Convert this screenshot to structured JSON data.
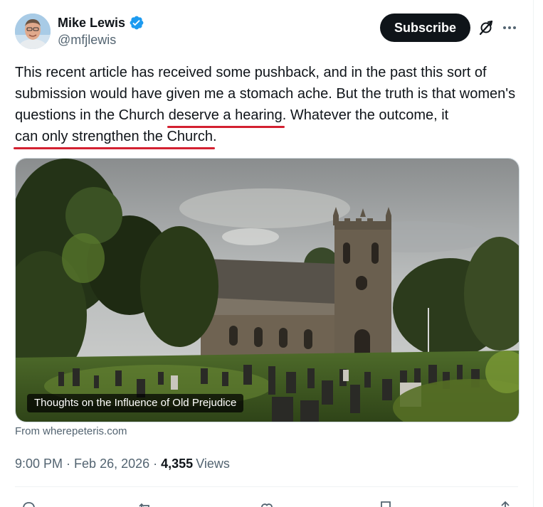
{
  "author": {
    "name": "Mike Lewis",
    "handle": "@mfjlewis",
    "verified": true
  },
  "header": {
    "subscribe_label": "Subscribe"
  },
  "tweet": {
    "text_part1": "This recent article has received some pushback, and in the past this sort of submission would have given me a stomach ache. But the truth is that women's questions in the Church ",
    "highlight1": "deserve a hearing",
    "text_part2": ". Whatever the outcome, it ",
    "highlight2": "can only strengthen the Church",
    "text_part3": ".",
    "highlight_color": "#d32030"
  },
  "card": {
    "caption": "Thoughts on the Influence of Old Prejudice",
    "source": "From wherepeteris.com"
  },
  "meta": {
    "time": "9:00 PM",
    "separator": "·",
    "date": "Feb 26, 2026",
    "views_count": "4,355",
    "views_label": "Views"
  },
  "icons": {
    "verified": "verified-badge-icon",
    "grok": "grok-icon",
    "more": "more-options-icon",
    "actions": [
      "reply-icon",
      "repost-icon",
      "like-icon",
      "bookmark-icon",
      "share-icon"
    ]
  },
  "colors": {
    "text": "#0f1419",
    "secondary": "#536471",
    "verified": "#1d9bf0",
    "subscribe_bg": "#0f1419"
  }
}
